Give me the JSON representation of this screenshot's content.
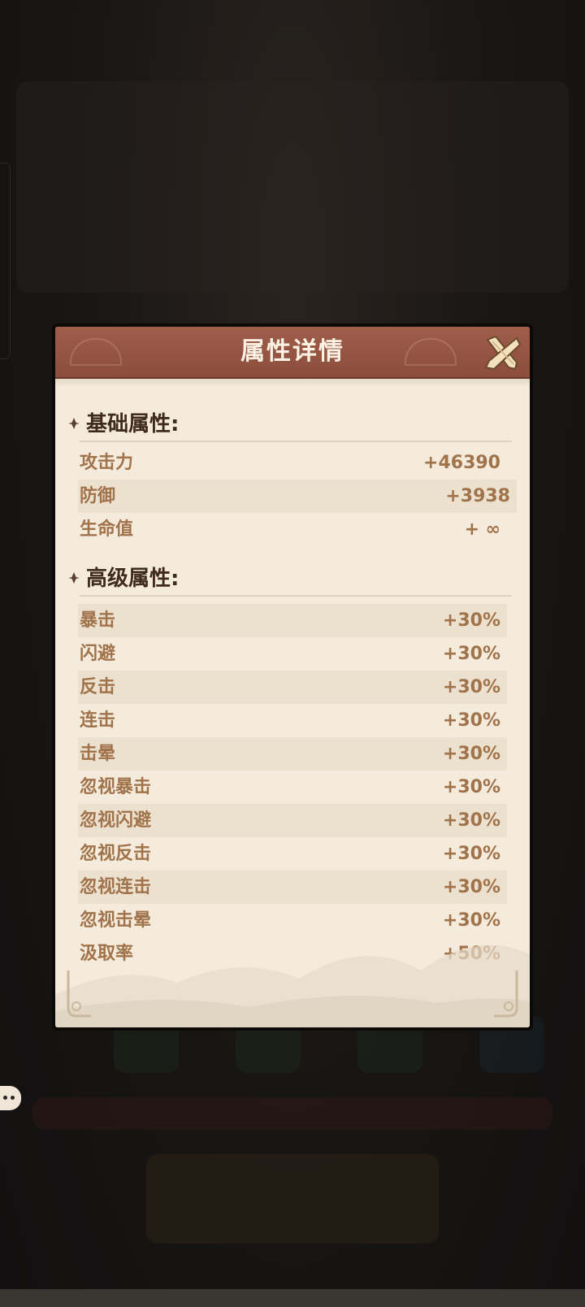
{
  "dialog": {
    "title": "属性详情",
    "close_icon": "close-x-icon"
  },
  "basic": {
    "label": "基础属性:",
    "rows": [
      {
        "name": "攻击力",
        "value": "+46390"
      },
      {
        "name": "防御",
        "value": "+3938"
      },
      {
        "name": "生命值",
        "value": "+ ∞"
      }
    ]
  },
  "advanced": {
    "label": "高级属性:",
    "rows": [
      {
        "name": "暴击",
        "value": "+30%"
      },
      {
        "name": "闪避",
        "value": "+30%"
      },
      {
        "name": "反击",
        "value": "+30%"
      },
      {
        "name": "连击",
        "value": "+30%"
      },
      {
        "name": "击晕",
        "value": "+30%"
      },
      {
        "name": "忽视暴击",
        "value": "+30%"
      },
      {
        "name": "忽视闪避",
        "value": "+30%"
      },
      {
        "name": "忽视反击",
        "value": "+30%"
      },
      {
        "name": "忽视连击",
        "value": "+30%"
      },
      {
        "name": "忽视击晕",
        "value": "+30%"
      },
      {
        "name": "汲取率",
        "value": "+50%"
      }
    ]
  },
  "colors": {
    "header": "#8c4d3c",
    "paper": "#f4ebdc",
    "row_shade": "#ece1cf",
    "attribute_text": "#a0734b",
    "section_text": "#3f2a1f"
  }
}
